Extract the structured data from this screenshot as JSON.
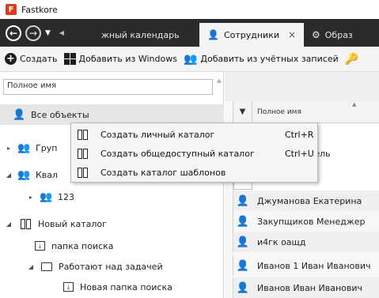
{
  "app": {
    "title": "Fastkore",
    "logo_letter": "F"
  },
  "tabs": [
    {
      "label": "жный календарь",
      "active": false
    },
    {
      "label": "Сотрудники",
      "active": true,
      "close": "×"
    },
    {
      "label": "Образ",
      "active": false
    }
  ],
  "toolbar": {
    "create": "Создать",
    "add_windows": "Добавить из Windows",
    "add_accounts": "Добавить из учётных записей"
  },
  "left": {
    "search_placeholder": "Полное имя",
    "tree": [
      {
        "label": "Все объекты",
        "icon": "user-icon",
        "selected": true
      },
      {
        "label": "Груп",
        "icon": "users-icon",
        "expander": "▸"
      },
      {
        "label": "Квал",
        "icon": "qualification-icon",
        "expander": "◢"
      },
      {
        "label": "123",
        "icon": "qualification-icon",
        "expander": "▸"
      },
      {
        "label": "Новый каталог",
        "icon": "catalog-icon",
        "expander": "◢"
      },
      {
        "label": "папка поиска",
        "icon": "search-folder-icon"
      },
      {
        "label": "Работают над задачей",
        "icon": "folder-icon",
        "expander": "◢"
      },
      {
        "label": "Новая папка поиска",
        "icon": "search-folder-icon"
      }
    ]
  },
  "grid": {
    "column_header": "Полное имя",
    "filter_partial": "ователь",
    "rows": [
      "Джуманова Екатерина",
      "Закупщиков Менеджер",
      "и4гк оащд",
      "Иванов 1 Иван Иванович",
      "Иванов Иван Иванович"
    ]
  },
  "context_menu": {
    "items": [
      {
        "label": "Создать личный каталог",
        "shortcut": "Ctrl+R"
      },
      {
        "label": "Создать общедоступный каталог",
        "shortcut": "Ctrl+U"
      },
      {
        "label": "Создать каталог шаблонов",
        "shortcut": ""
      }
    ]
  },
  "colors": {
    "tabbar_bg": "#2b2b2b",
    "logo_red": "#e03a1f",
    "selected_bg": "#e6e6e6"
  }
}
